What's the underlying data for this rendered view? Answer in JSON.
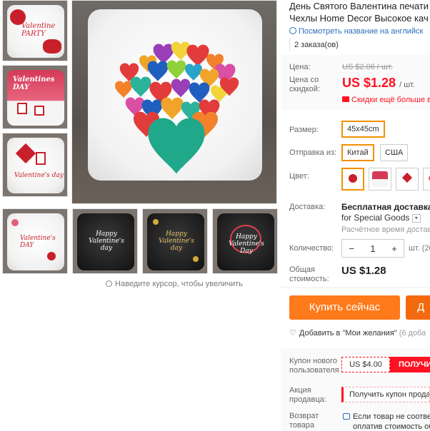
{
  "product": {
    "title_line1": "День Святого Валентина печати",
    "title_line2": "Чехлы Home Decor Высокое кач",
    "translate_link": "Посмотреть название на английск",
    "orders": "2 заказа(ов)"
  },
  "price": {
    "label": "Цена:",
    "old": "US $2.06 / шт.",
    "discount_label": "Цена со скидкой:",
    "new": "US $1.28",
    "unit": "/ шт.",
    "extra_discount": "Скидки ещё больше в"
  },
  "options": {
    "size_label": "Размер:",
    "size_value": "45x45cm",
    "ship_from_label": "Отправка из:",
    "ship_from": [
      "Китай",
      "США"
    ],
    "color_label": "Цвет:"
  },
  "delivery": {
    "label": "Доставка:",
    "free": "Бесплатная доставка в",
    "for": "for Special Goods",
    "estimate": "Расчётное время доставк"
  },
  "quantity": {
    "label": "Количество:",
    "minus": "−",
    "value": "1",
    "plus": "+",
    "unit": "шт. (20"
  },
  "total": {
    "label": "Общая стоимость:",
    "value": "US $1.28"
  },
  "actions": {
    "buy_now": "Купить сейчас",
    "add_to_cart": "Д",
    "wishlist": "Добавить в \"Мои желания\"",
    "wishlist_count": "(6 доба"
  },
  "coupons": {
    "new_user_label": "Купон нового пользователя",
    "new_user_value": "US $4.00",
    "get": "ПОЛУЧИ",
    "seller_label": "Акция продавца:",
    "seller_button": "Получить купон прода",
    "return_label": "Возврат товара",
    "return_line1": "Если товар не соответ",
    "return_line2": "оплатив стоимость об"
  },
  "gallery": {
    "zoom_hint": "Наведите курсор, чтобы увеличить",
    "thumb_texts": [
      "Valentine PARTY",
      "Valentines DAY",
      "Valentine's day",
      "Valentine's DAY",
      "Happy Valentine's day",
      "Happy Valentine's day",
      "Happy Valentine's Day"
    ]
  },
  "colors": {
    "accent": "#f29000",
    "price_red": "#ff1122",
    "buy_orange": "#ff7a1a",
    "link_blue": "#2a6ebb"
  }
}
